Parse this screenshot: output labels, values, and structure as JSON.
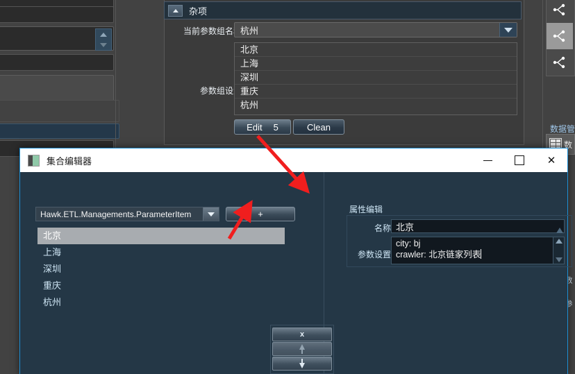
{
  "app": {
    "group_panel": {
      "header_title": "杂项",
      "toggle_icon": "collapse-arrow-icon",
      "current_group_label": "当前参数组名称",
      "current_group_value": "杭州",
      "param_group_label": "参数组设置",
      "items": [
        "北京",
        "上海",
        "深圳",
        "重庆",
        "杭州"
      ],
      "edit_button": "Edit",
      "edit_button_count": "5",
      "clean_button": "Clean"
    },
    "right_toolbar": {
      "icons": [
        "share-node-icon",
        "share-node-icon",
        "share-node-icon"
      ],
      "label": "数据管",
      "card_icon": "table-grid-icon",
      "card_text": "数"
    }
  },
  "dialog": {
    "title": "集合编辑器",
    "title_icon": "collection-editor-icon",
    "window_controls": {
      "minimize": "minimize-icon",
      "maximize": "maximize-icon",
      "close": "✕"
    },
    "type_combo_value": "Hawk.ETL.Managements.ParameterItem",
    "type_combo_arrow": "chevron-down-icon",
    "add_button": "+",
    "items": [
      "北京",
      "上海",
      "深圳",
      "重庆",
      "杭州"
    ],
    "selected_index": 0,
    "order_buttons": {
      "delete": "x",
      "move_up": "↑",
      "move_down": "↓"
    },
    "property_panel": {
      "title": "属性编辑",
      "name_label": "名称",
      "name_value": "北京",
      "params_label": "参数设置",
      "params_value_line1": "city: bj",
      "params_value_line2": "crawler: 北京链家列表"
    }
  },
  "colors": {
    "app_bg": "#424242",
    "dialog_bg": "#243746",
    "dialog_border": "#1e90d6",
    "accent_red": "#f01e1e",
    "selection": "#a8acb0"
  }
}
